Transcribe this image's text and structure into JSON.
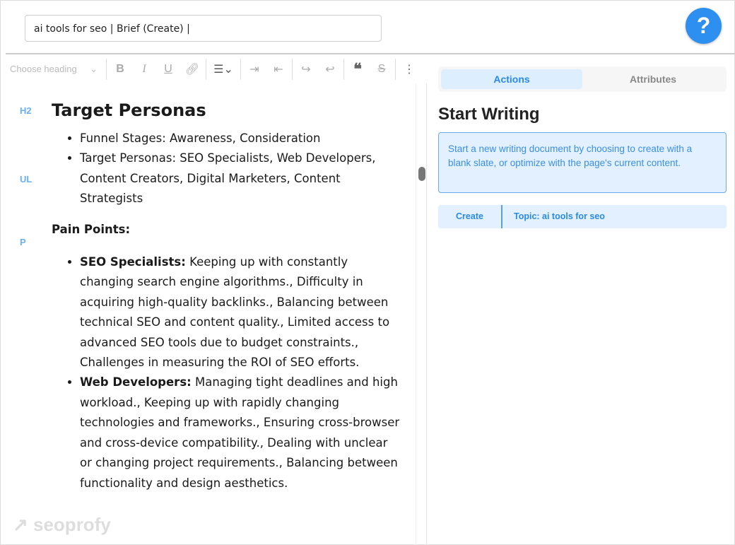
{
  "header": {
    "title_value": "ai tools for seo | Brief (Create) |",
    "help_label": "?"
  },
  "toolbar": {
    "heading_placeholder": "Choose heading",
    "icons": [
      "bold-icon",
      "italic-icon",
      "underline-icon",
      "link-icon",
      "bullet-list-icon",
      "indent-icon",
      "outdent-icon",
      "redo-icon",
      "undo-icon",
      "blockquote-icon",
      "strikethrough-icon",
      "more-icon"
    ]
  },
  "editor": {
    "tags": {
      "h2": "H2",
      "ul": "UL",
      "p": "P"
    },
    "heading": "Target Personas",
    "list1": [
      "Funnel Stages: Awareness, Consideration",
      "Target Personas: SEO Specialists, Web Developers, Content Creators, Digital Marketers, Content Strategists"
    ],
    "pain_title": "Pain Points:",
    "pain": [
      {
        "label": "SEO Specialists:",
        "text": " Keeping up with constantly changing search engine algorithms., Difficulty in acquiring high-quality backlinks., Balancing between technical SEO and content quality., Limited access to advanced SEO tools due to budget constraints., Challenges in measuring the ROI of SEO efforts."
      },
      {
        "label": "Web Developers:",
        "text": " Managing tight deadlines and high workload., Keeping up with rapidly changing technologies and frameworks., Ensuring cross-browser and cross-device compatibility., Dealing with unclear or changing project requirements., Balancing between functionality and design aesthetics."
      }
    ]
  },
  "watermark": "↗ seoprofy",
  "panel": {
    "tabs": [
      "Actions",
      "Attributes"
    ],
    "title": "Start Writing",
    "info": "Start a new writing document by choosing to create with a blank slate, or optimize with the page's current content.",
    "create_label": "Create",
    "topic_label": "Topic: ai tools for seo"
  },
  "colors": {
    "accent": "#2d8ff0",
    "info_bg": "#e2f0ff"
  }
}
